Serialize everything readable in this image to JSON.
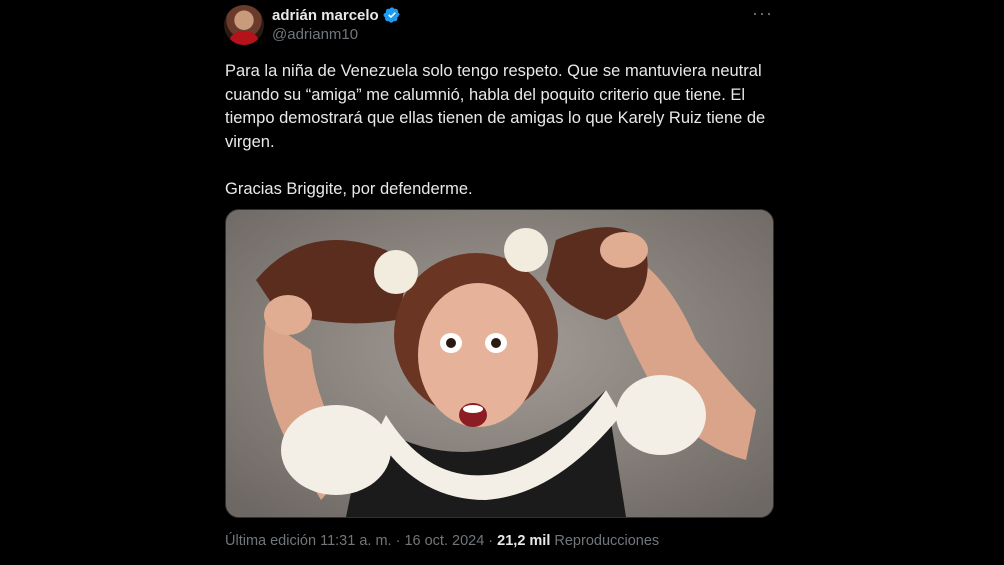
{
  "tweet": {
    "author_name": "adrián marcelo",
    "author_handle": "@adrianm10",
    "text": "Para la niña de Venezuela solo tengo respeto. Que se mantuviera neutral cuando su “amiga” me calumnió, habla del poquito criterio que tiene. El tiempo demostrará que ellas tienen de amigas lo que Karely Ruiz tiene de virgen.\n\nGracias Briggite, por defenderme.",
    "edited_label": "Última edición 11:31 a. m. · 16 oct. 2024 · ",
    "views_count": "21,2 mil",
    "views_label": "Reproducciones"
  },
  "icons": {
    "verified": "verified-badge-icon",
    "more": "more-dots-icon"
  },
  "colors": {
    "background": "#000000",
    "text": "#e7e9ea",
    "secondary": "#71767b",
    "verified": "#1d9bf0"
  }
}
